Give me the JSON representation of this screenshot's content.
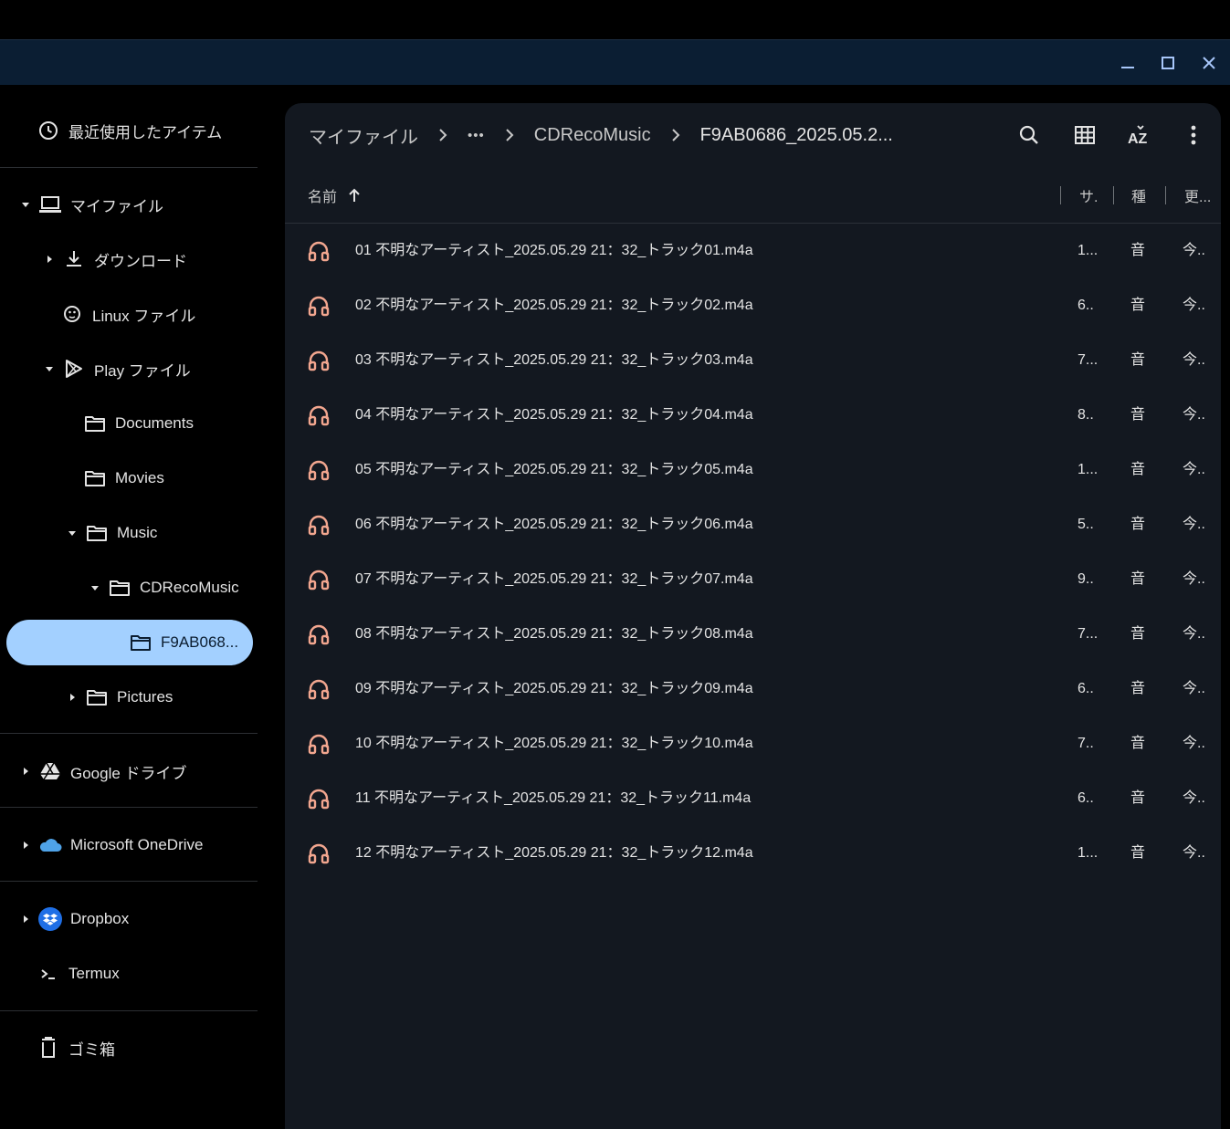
{
  "window": {
    "minimize_label": "minimize",
    "maximize_label": "maximize",
    "close_label": "close"
  },
  "sidebar": {
    "recent": "最近使用したアイテム",
    "my_files": "マイファイル",
    "downloads": "ダウンロード",
    "linux_files": "Linux ファイル",
    "play_files": "Play ファイル",
    "documents": "Documents",
    "movies": "Movies",
    "music": "Music",
    "cdreco": "CDRecoMusic",
    "selected_folder": "F9AB068...",
    "pictures": "Pictures",
    "google_drive": "Google ドライブ",
    "onedrive": "Microsoft OneDrive",
    "dropbox": "Dropbox",
    "termux": "Termux",
    "trash": "ゴミ箱"
  },
  "breadcrumb": {
    "root": "マイファイル",
    "ellipsis": "•••",
    "parent": "CDRecoMusic",
    "current": "F9AB0686_2025.05.2..."
  },
  "columns": {
    "name": "名前",
    "size": "サ.",
    "type": "種",
    "modified": "更..."
  },
  "files": [
    {
      "name": "01 不明なアーティスト_2025.05.29 21：32_トラック01.m4a",
      "size": "1...",
      "type": "音",
      "modified": "今.."
    },
    {
      "name": "02 不明なアーティスト_2025.05.29 21：32_トラック02.m4a",
      "size": "6..",
      "type": "音",
      "modified": "今.."
    },
    {
      "name": "03 不明なアーティスト_2025.05.29 21：32_トラック03.m4a",
      "size": "7...",
      "type": "音",
      "modified": "今.."
    },
    {
      "name": "04 不明なアーティスト_2025.05.29 21：32_トラック04.m4a",
      "size": "8..",
      "type": "音",
      "modified": "今.."
    },
    {
      "name": "05 不明なアーティスト_2025.05.29 21：32_トラック05.m4a",
      "size": "1...",
      "type": "音",
      "modified": "今.."
    },
    {
      "name": "06 不明なアーティスト_2025.05.29 21：32_トラック06.m4a",
      "size": "5..",
      "type": "音",
      "modified": "今.."
    },
    {
      "name": "07 不明なアーティスト_2025.05.29 21：32_トラック07.m4a",
      "size": "9..",
      "type": "音",
      "modified": "今.."
    },
    {
      "name": "08 不明なアーティスト_2025.05.29 21：32_トラック08.m4a",
      "size": "7...",
      "type": "音",
      "modified": "今.."
    },
    {
      "name": "09 不明なアーティスト_2025.05.29 21：32_トラック09.m4a",
      "size": "6..",
      "type": "音",
      "modified": "今.."
    },
    {
      "name": "10 不明なアーティスト_2025.05.29 21：32_トラック10.m4a",
      "size": "7..",
      "type": "音",
      "modified": "今.."
    },
    {
      "name": "11 不明なアーティスト_2025.05.29 21：32_トラック11.m4a",
      "size": "6..",
      "type": "音",
      "modified": "今.."
    },
    {
      "name": "12 不明なアーティスト_2025.05.29 21：32_トラック12.m4a",
      "size": "1...",
      "type": "音",
      "modified": "今.."
    }
  ],
  "colors": {
    "background": "#000000",
    "titlebar": "#0b1e33",
    "panel": "#131820",
    "selected": "#a3d0ff",
    "audio_icon": "#f2a68f"
  }
}
